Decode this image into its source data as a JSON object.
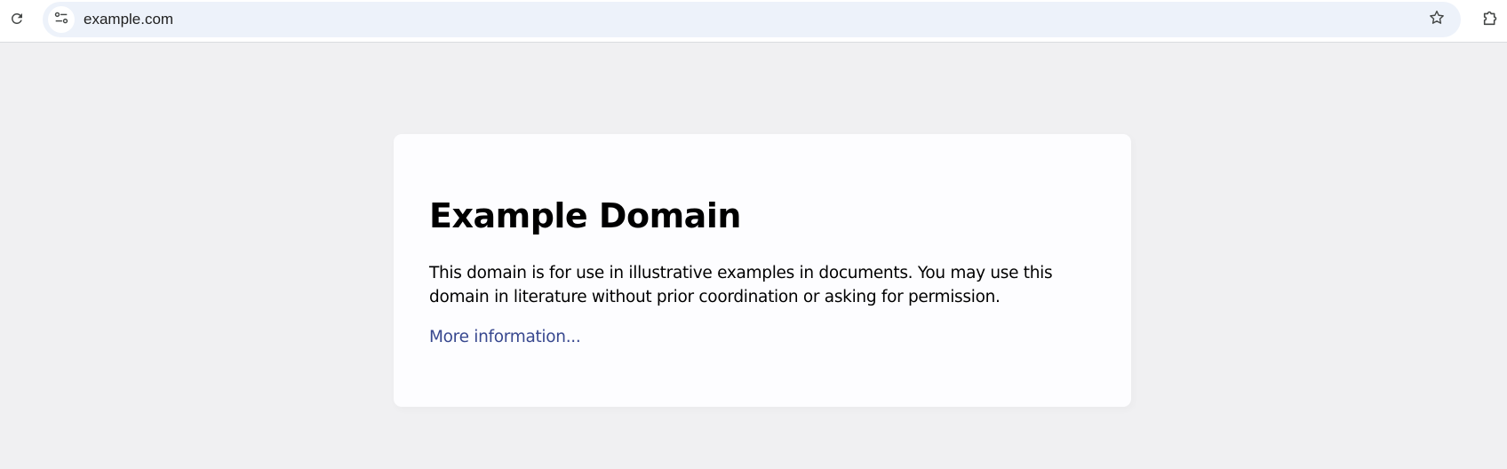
{
  "browser": {
    "url": "example.com",
    "icons": {
      "reload": "reload-icon",
      "site_info": "tune-icon",
      "bookmark": "star-icon",
      "extensions": "puzzle-icon"
    }
  },
  "page": {
    "title": "Example Domain",
    "description": "This domain is for use in illustrative examples in documents. You may use this domain in literature without prior coordination or asking for permission.",
    "link_text": "More information..."
  },
  "colors": {
    "page_background": "#f0f0f2",
    "card_background": "#fdfdff",
    "link": "#38488f",
    "omnibox": "#edf2fa"
  }
}
